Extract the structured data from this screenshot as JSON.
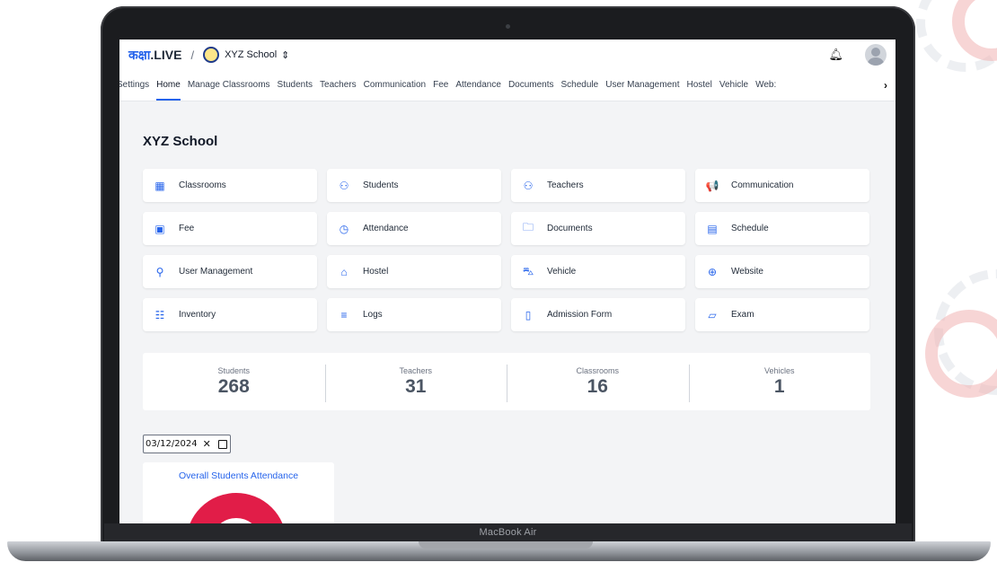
{
  "device": {
    "label": "MacBook Air"
  },
  "topbar": {
    "brand_devanagari": "कक्षा",
    "brand_latin": ".LIVE",
    "separator": "/",
    "school_name": "XYZ School",
    "school_switch_icon": "chevron-updown-icon",
    "notification_icon": "bell-icon",
    "avatar_icon": "user-avatar-icon"
  },
  "nav": {
    "tabs": [
      {
        "label": "Settings",
        "active": false
      },
      {
        "label": "Home",
        "active": true
      },
      {
        "label": "Manage Classrooms",
        "active": false
      },
      {
        "label": "Students",
        "active": false
      },
      {
        "label": "Teachers",
        "active": false
      },
      {
        "label": "Communication",
        "active": false
      },
      {
        "label": "Fee",
        "active": false
      },
      {
        "label": "Attendance",
        "active": false
      },
      {
        "label": "Documents",
        "active": false
      },
      {
        "label": "Schedule",
        "active": false
      },
      {
        "label": "User Management",
        "active": false
      },
      {
        "label": "Hostel",
        "active": false
      },
      {
        "label": "Vehicle",
        "active": false
      },
      {
        "label": "Web:",
        "active": false
      }
    ],
    "scroll_icon": "chevron-right-icon"
  },
  "page": {
    "title": "XYZ School"
  },
  "modules": [
    {
      "label": "Classrooms",
      "icon": "building-icon",
      "glyph": "▦"
    },
    {
      "label": "Students",
      "icon": "users-icon",
      "glyph": "⚇"
    },
    {
      "label": "Teachers",
      "icon": "users-icon",
      "glyph": "⚇"
    },
    {
      "label": "Communication",
      "icon": "megaphone-icon",
      "glyph": "📢"
    },
    {
      "label": "Fee",
      "icon": "money-icon",
      "glyph": "▣"
    },
    {
      "label": "Attendance",
      "icon": "clock-icon",
      "glyph": "◷"
    },
    {
      "label": "Documents",
      "icon": "folder-icon",
      "glyph": "🗀"
    },
    {
      "label": "Schedule",
      "icon": "calendar-icon",
      "glyph": "▤"
    },
    {
      "label": "User Management",
      "icon": "user-settings-icon",
      "glyph": "⚲"
    },
    {
      "label": "Hostel",
      "icon": "home-icon",
      "glyph": "⌂"
    },
    {
      "label": "Vehicle",
      "icon": "car-icon",
      "glyph": "⛍"
    },
    {
      "label": "Website",
      "icon": "globe-icon",
      "glyph": "⊕"
    },
    {
      "label": "Inventory",
      "icon": "inventory-icon",
      "glyph": "☷"
    },
    {
      "label": "Logs",
      "icon": "search-list-icon",
      "glyph": "≡"
    },
    {
      "label": "Admission Form",
      "icon": "clipboard-icon",
      "glyph": "▯"
    },
    {
      "label": "Exam",
      "icon": "document-edit-icon",
      "glyph": "▱"
    }
  ],
  "stats": [
    {
      "label": "Students",
      "value": "268"
    },
    {
      "label": "Teachers",
      "value": "31"
    },
    {
      "label": "Classrooms",
      "value": "16"
    },
    {
      "label": "Vehicles",
      "value": "1"
    }
  ],
  "date_filter": {
    "value": "03/12/2024",
    "clear_label": "✕",
    "calendar_icon": "calendar-icon"
  },
  "attendance": {
    "title": "Overall Students Attendance"
  },
  "colors": {
    "accent": "#2563eb",
    "attendance_donut": "#e11d48"
  }
}
